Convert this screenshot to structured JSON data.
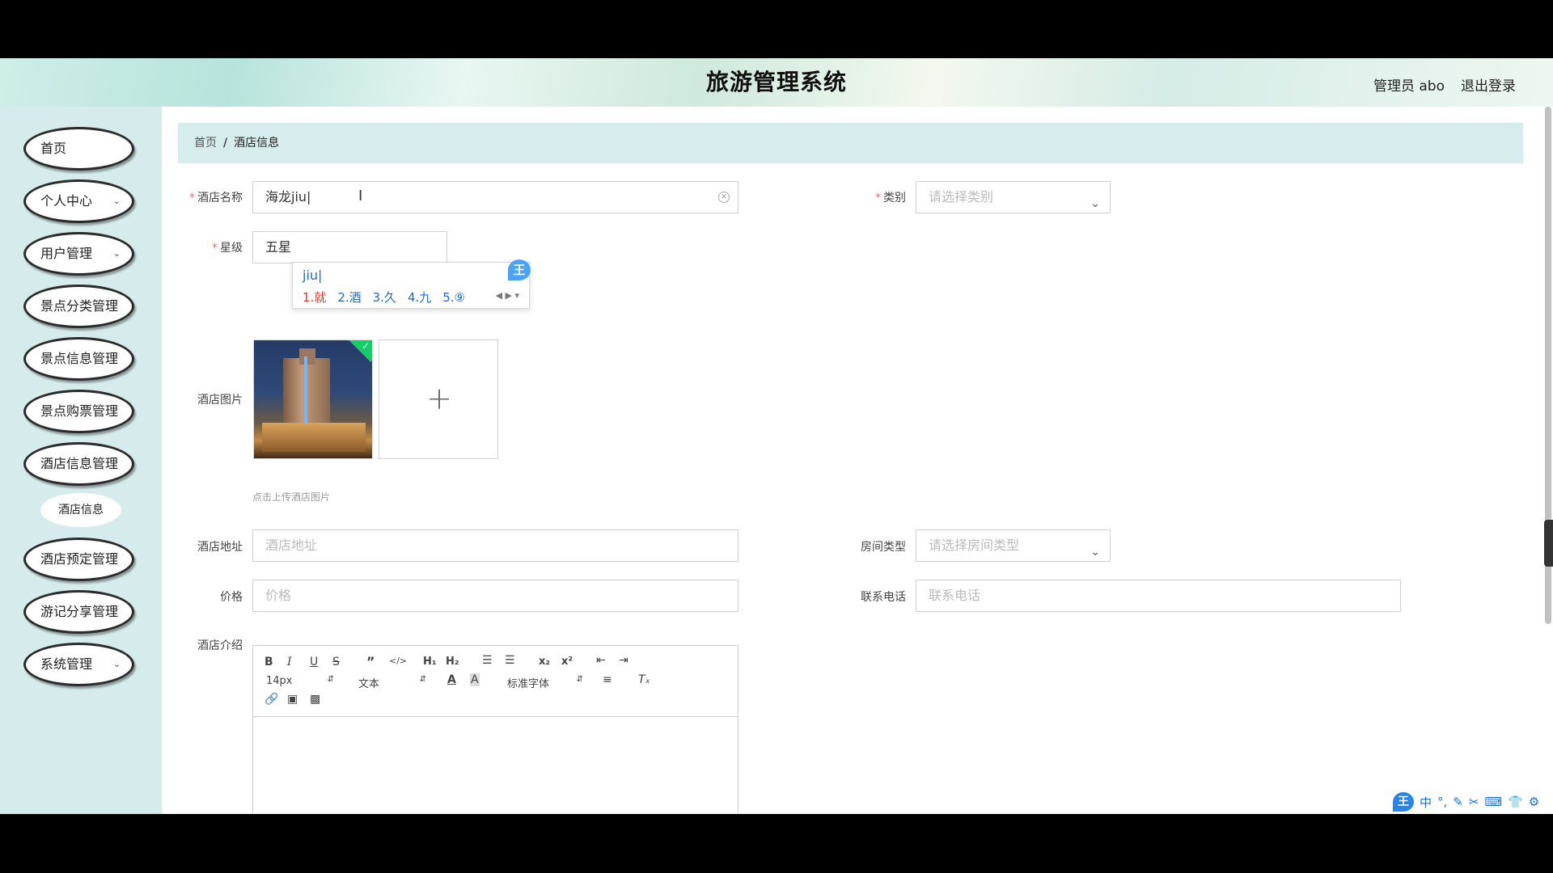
{
  "app": {
    "title": "旅游管理系统",
    "user_label": "管理员 abo",
    "logout_label": "退出登录"
  },
  "sidebar": {
    "items": [
      {
        "label": "首页",
        "has_submenu": false
      },
      {
        "label": "个人中心",
        "has_submenu": true
      },
      {
        "label": "用户管理",
        "has_submenu": true
      },
      {
        "label": "景点分类管理",
        "has_submenu": false
      },
      {
        "label": "景点信息管理",
        "has_submenu": false
      },
      {
        "label": "景点购票管理",
        "has_submenu": false
      },
      {
        "label": "酒店信息管理",
        "has_submenu": false
      },
      {
        "label": "酒店预定管理",
        "has_submenu": false
      },
      {
        "label": "游记分享管理",
        "has_submenu": false
      },
      {
        "label": "系统管理",
        "has_submenu": true
      }
    ],
    "subitem": {
      "label": "酒店信息"
    }
  },
  "breadcrumb": {
    "home": "首页",
    "separator": "/",
    "current": "酒店信息"
  },
  "form": {
    "hotel_name": {
      "label": "酒店名称",
      "value": "海龙jiu",
      "required": true
    },
    "category": {
      "label": "类别",
      "placeholder": "请选择类别",
      "required": true
    },
    "star": {
      "label": "星级",
      "value": "五星",
      "required": true
    },
    "image": {
      "label": "酒店图片",
      "hint": "点击上传酒店图片",
      "uploaded_count": 1
    },
    "address": {
      "label": "酒店地址",
      "placeholder": "酒店地址"
    },
    "room_type": {
      "label": "房间类型",
      "placeholder": "请选择房间类型"
    },
    "price": {
      "label": "价格",
      "placeholder": "价格"
    },
    "phone": {
      "label": "联系电话",
      "placeholder": "联系电话"
    },
    "intro": {
      "label": "酒店介绍"
    }
  },
  "ime": {
    "composition": "jiu",
    "candidates": [
      "1.就",
      "2.酒",
      "3.久",
      "4.九",
      "5.⑨"
    ],
    "badge": "王",
    "tray": [
      "王",
      "中",
      "°,",
      "✎",
      "✂",
      "⌨",
      "👕",
      "⚙"
    ]
  },
  "editor": {
    "font_size": "14px",
    "block_type": "文本",
    "font_family": "标准字体",
    "h1": "H₁",
    "h2": "H₂",
    "sub": "x₂",
    "sup": "x²"
  },
  "colors": {
    "sidebar_bg": "#d6ecec",
    "breadcrumb_bg": "#d7ecec",
    "required": "#f56c6c",
    "upload_success": "#13ce66",
    "ime_blue": "#2468c7"
  }
}
